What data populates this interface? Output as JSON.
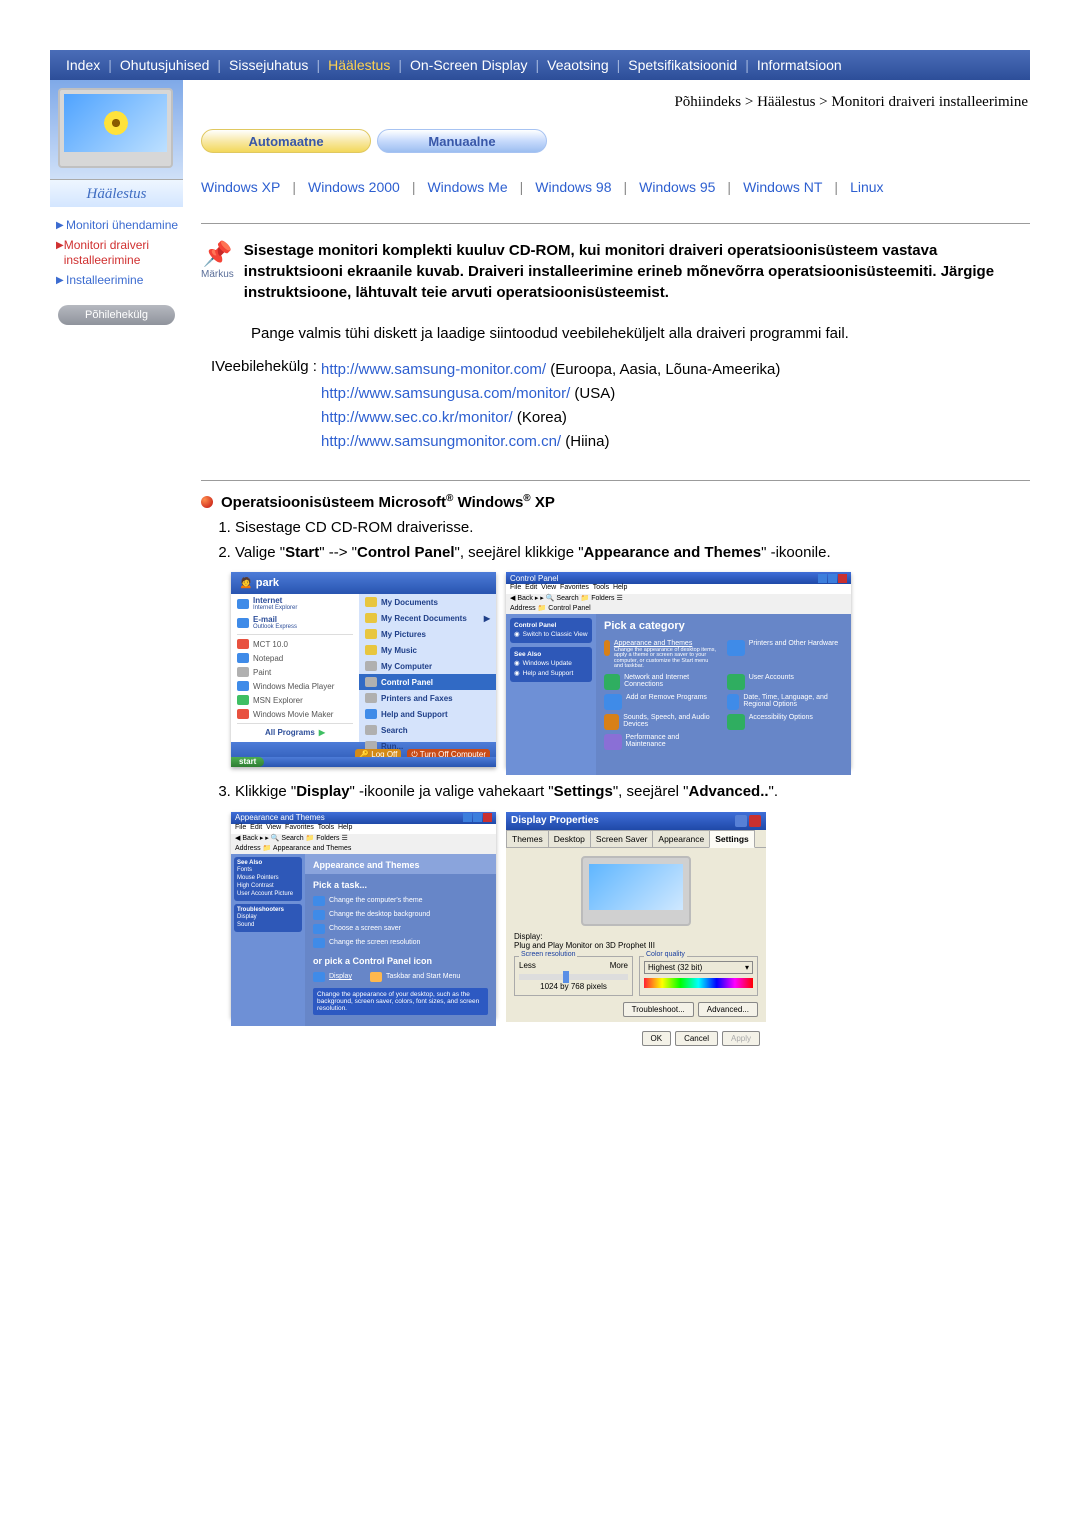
{
  "topnav": {
    "items": [
      "Index",
      "Ohutusjuhised",
      "Sissejuhatus",
      "Häälestus",
      "On-Screen Display",
      "Veaotsing",
      "Spetsifikatsioonid",
      "Informatsioon"
    ],
    "active_index": 3
  },
  "breadcrumb": "Põhiindeks > Häälestus > Monitori draiveri installeerimine",
  "tabs": {
    "auto": "Automaatne",
    "manual": "Manuaalne"
  },
  "oslist": [
    "Windows XP",
    "Windows 2000",
    "Windows Me",
    "Windows 98",
    "Windows 95",
    "Windows NT",
    "Linux"
  ],
  "sidebar": {
    "section": "Häälestus",
    "items": [
      {
        "label": "Monitori ühendamine",
        "active": false
      },
      {
        "label": "Monitori draiveri installeerimine",
        "active": true
      },
      {
        "label": "Installeerimine",
        "active": false
      }
    ],
    "backbtn": "Põhilehekülg"
  },
  "note": {
    "icon_label": "Märkus",
    "text": "Sisestage monitori komplekti kuuluv CD-ROM, kui monitori draiveri operatsioonisüsteem vastava instruktsiooni ekraanile kuvab. Draiveri installeerimine erineb mõnevõrra operatsioonisüsteemiti. Järgige instruktsioone, lähtuvalt teie arvuti operatsioonisüsteemist."
  },
  "para_prepare": "Pange valmis tühi diskett ja laadige siintoodud veebileheküljelt alla draiveri programmi fail.",
  "weblabel": "IVeebilehekülg :",
  "weblinks": [
    {
      "url": "http://www.samsung-monitor.com/",
      "region": " (Euroopa, Aasia, Lõuna-Ameerika)"
    },
    {
      "url": "http://www.samsungusa.com/monitor/",
      "region": " (USA)"
    },
    {
      "url": "http://www.sec.co.kr/monitor/",
      "region": " (Korea)"
    },
    {
      "url": "http://www.samsungmonitor.com.cn/",
      "region": " (Hiina)"
    }
  ],
  "xp": {
    "heading_pre": "Operatsioonisüsteem Microsoft",
    "heading_mid": " Windows",
    "heading_post": " XP",
    "step1": "Sisestage CD CD-ROM draiverisse.",
    "step2_a": "Valige \"",
    "step2_b": "Start",
    "step2_c": "\" --> \"",
    "step2_d": "Control Panel",
    "step2_e": "\", seejärel klikkige \"",
    "step2_f": "Appearance and Themes",
    "step2_g": "\" -ikoonile.",
    "step3_a": "Klikkige \"",
    "step3_b": "Display",
    "step3_c": "\" -ikoonile ja valige vahekaart \"",
    "step3_d": "Settings",
    "step3_e": "\", seejärel \"",
    "step3_f": "Advanced..",
    "step3_g": "\"."
  },
  "startmenu": {
    "user": "park",
    "left": [
      {
        "t": "Internet",
        "s": "Internet Explorer"
      },
      {
        "t": "E-mail",
        "s": "Outlook Express"
      },
      {
        "t": "MCT 10.0",
        "s": ""
      },
      {
        "t": "Notepad",
        "s": ""
      },
      {
        "t": "Paint",
        "s": ""
      },
      {
        "t": "Windows Media Player",
        "s": ""
      },
      {
        "t": "MSN Explorer",
        "s": ""
      },
      {
        "t": "Windows Movie Maker",
        "s": ""
      }
    ],
    "allprograms": "All Programs",
    "right": [
      "My Documents",
      "My Recent Documents",
      "My Pictures",
      "My Music",
      "My Computer",
      "Control Panel",
      "Printers and Faxes",
      "Help and Support",
      "Search",
      "Run..."
    ],
    "right_hl_index": 5,
    "logoff": "Log Off",
    "turnoff": "Turn Off Computer",
    "startbtn": "start"
  },
  "cpanel": {
    "title": "Control Panel",
    "leftbox_title": "Control Panel",
    "leftbox_rows": [
      "Switch to Classic View"
    ],
    "leftbox2_title": "See Also",
    "leftbox2_rows": [
      "Windows Update",
      "Help and Support"
    ],
    "heading": "Pick a category",
    "items": [
      "Appearance and Themes",
      "Printers and Other Hardware",
      "Network and Internet Connections",
      "User Accounts",
      "Add or Remove Programs",
      "Date, Time, Language, and Regional Options",
      "Sounds, Speech, and Audio Devices",
      "Accessibility Options",
      "Performance and Maintenance"
    ],
    "item_desc": "Change the appearance of desktop items, apply a theme or screen saver to your computer, or customize the Start menu and taskbar."
  },
  "appthemes": {
    "title": "Appearance and Themes",
    "leftboxes": [
      {
        "h": "See Also",
        "rows": [
          "Fonts",
          "Mouse Pointers",
          "High Contrast",
          "User Account Picture"
        ]
      },
      {
        "h": "Troubleshooters",
        "rows": [
          "Display",
          "Sound"
        ]
      }
    ],
    "heading1": "Appearance and Themes",
    "task_heading": "Pick a task...",
    "tasks": [
      "Change the computer's theme",
      "Change the desktop background",
      "Choose a screen saver",
      "Change the screen resolution"
    ],
    "or_heading": "or pick a Control Panel icon",
    "icons": [
      "Display",
      "Taskbar and Start Menu"
    ],
    "hl_text": "Change the appearance of your desktop, such as the background, screen saver, colors, font sizes, and screen resolution."
  },
  "dispprops": {
    "title": "Display Properties",
    "tabs": [
      "Themes",
      "Desktop",
      "Screen Saver",
      "Appearance",
      "Settings"
    ],
    "active_tab": 4,
    "display_label": "Display:",
    "display_value": "Plug and Play Monitor on 3D Prophet III",
    "res_group": "Screen resolution",
    "res_less": "Less",
    "res_more": "More",
    "res_value": "1024 by 768 pixels",
    "col_group": "Color quality",
    "col_value": "Highest (32 bit)",
    "troubleshoot": "Troubleshoot...",
    "advanced": "Advanced...",
    "ok": "OK",
    "cancel": "Cancel",
    "apply": "Apply"
  }
}
